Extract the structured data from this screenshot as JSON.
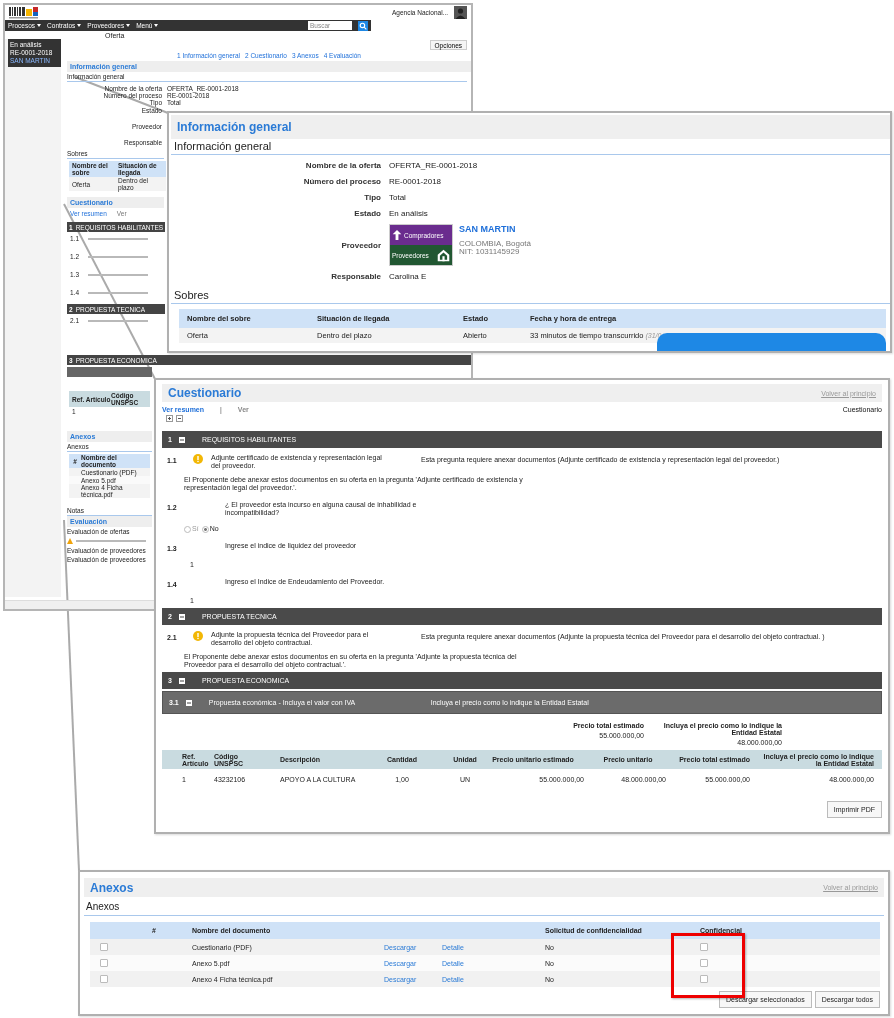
{
  "page": {
    "nav": [
      "Procesos",
      "Contratos",
      "Proveedores",
      "Menú"
    ],
    "search_placeholder": "Buscar",
    "account": "Agencia Nacional...",
    "breadcrumb": "Oferta",
    "status_box": [
      "En análisis",
      "RE-0001-2018",
      "SAN MARTIN"
    ],
    "options": "Opciones",
    "anchors": [
      "1 Información general",
      "2 Cuestionario",
      "3 Anexos",
      "4 Evaluación"
    ],
    "info_title": "Información general",
    "info_sub": "Información general",
    "fields": [
      {
        "label": "Nombre de la oferta",
        "value": "OFERTA_RE-0001-2018"
      },
      {
        "label": "Número del proceso",
        "value": "RE-0001-2018"
      },
      {
        "label": "Tipo",
        "value": "Total"
      },
      {
        "label": "Estado"
      },
      {
        "label": "Proveedor"
      },
      {
        "label": "Responsable"
      }
    ],
    "sobres_title": "Sobres",
    "sobres_columns": [
      "Nombre del sobre",
      "Situación de llegada"
    ],
    "sobres_row": [
      "Oferta",
      "Dentro del plazo"
    ],
    "cuestionario_title": "Cuestionario",
    "view_links": [
      "Ver resumen",
      "Ver"
    ],
    "sections": [
      {
        "number": "1",
        "title": "REQUISITOS HABILITANTES",
        "items": [
          "1.1",
          "1.2",
          "1.3",
          "1.4"
        ]
      },
      {
        "number": "2",
        "title": "PROPUESTA TECNICA",
        "items": [
          "2.1"
        ]
      },
      {
        "number": "3",
        "title": "PROPUESTA ECONOMICA"
      }
    ],
    "item_table_columns": [
      "Ref. Artículo",
      "Código UNSPSC"
    ],
    "item_table_row": [
      "1"
    ],
    "anexos_title": "Anexos",
    "anexos_sub": "Anexos",
    "anexos_columns": [
      "#",
      "Nombre del documento"
    ],
    "anexos_rows": [
      "Cuestionario (PDF)",
      "Anexo 5.pdf",
      "Anexo 4 Ficha técnica.pdf"
    ],
    "notas": "Notas",
    "evaluacion_title": "Evaluación",
    "evaluacion_ofertas": "Evaluación de ofertas",
    "evaluacion_proveedores": "Evaluación de proveedores",
    "evaluacion_proveedores_sub": "Evaluación de proveedores"
  },
  "info_zoom": {
    "title": "Información general",
    "subtitle": "Información general",
    "fields": [
      {
        "label": "Nombre de la oferta",
        "value": "OFERTA_RE-0001-2018"
      },
      {
        "label": "Número del proceso",
        "value": "RE-0001-2018"
      },
      {
        "label": "Tipo",
        "value": "Total"
      },
      {
        "label": "Estado",
        "value": "En análisis"
      }
    ],
    "provider": {
      "label": "Proveedor",
      "logo_top": "Compradores",
      "logo_bottom": "Proveedores",
      "name": "SAN MARTIN",
      "location": "COLOMBIA, Bogotá",
      "nit": "NIT: 1031145929"
    },
    "responsible": {
      "label": "Responsable",
      "value": "Carolina E"
    },
    "sobres_title": "Sobres",
    "sobres_columns": [
      "Nombre del sobre",
      "Situación de llegada",
      "Estado",
      "Fecha y hora de entrega"
    ],
    "sobres_row": {
      "name": "Oferta",
      "arrival": "Dentro del plazo",
      "state": "Abierto",
      "elapsed": "33 minutos de tiempo transcurrido",
      "date": "(31/0"
    }
  },
  "cuestionario_zoom": {
    "title": "Cuestionario",
    "back_link": "Volver al principio",
    "view_links": [
      {
        "label": "Ver resumen",
        "selected": true
      },
      {
        "label": "Ver",
        "selected": false
      }
    ],
    "view_separator": "|",
    "right_label": "Cuestionario",
    "sections": [
      {
        "number": "1",
        "title": "REQUISITOS HABILITANTES",
        "questions": [
          {
            "number": "1.1",
            "kind": "document",
            "text": "Adjunte certificado de existencia y representación legal del proveedor.",
            "requirement": "Esta pregunta requiere anexar documentos (Adjunte certificado de existencia y representación legal del proveedor.)",
            "note": "El Proponente debe anexar estos documentos en su oferta en la pregunta 'Adjunte certificado de existencia y representación legal del proveedor.'."
          },
          {
            "number": "1.2",
            "kind": "choice",
            "text": "¿ El proveedor esta incurso en alguna causal de inhabilidad e incompatibilidad?",
            "options": [
              {
                "label": "Sí",
                "selected": false
              },
              {
                "label": "No",
                "selected": true
              }
            ]
          },
          {
            "number": "1.3",
            "kind": "answer",
            "text": "Ingrese el indice de liquidez del proveedor",
            "answer": "1"
          },
          {
            "number": "1.4",
            "kind": "answer",
            "text": "Ingreso el Indice de Endeudamiento del Proveedor.",
            "answer": "1"
          }
        ]
      },
      {
        "number": "2",
        "title": "PROPUESTA TECNICA",
        "questions": [
          {
            "number": "2.1",
            "kind": "document",
            "text": "Adjunte la propuesta técnica del Proveedor para el desarrollo del objeto contractual.",
            "requirement": "Esta pregunta requiere anexar documentos (Adjunte la propuesta técnica del Proveedor para el desarrollo del objeto contractual. )",
            "note": "El Proponente debe anexar estos documentos en su oferta en la pregunta 'Adjunte la propuesta técnica del Proveedor para el desarrollo del objeto contractual.'."
          }
        ]
      },
      {
        "number": "3",
        "title": "PROPUESTA ECONOMICA"
      }
    ],
    "economic": {
      "number": "3.1",
      "text": "Propuesta económica - Incluya el valor con IVA",
      "hint": "Incluya el precio como lo indique la Entidad Estatal",
      "summary_labels": [
        "Precio total estimado",
        "Incluya el precio como lo indique la Entidad Estatal"
      ],
      "summary_values": [
        "55.000.000,00",
        "48.000.000,00"
      ],
      "columns": [
        "Ref. Artículo",
        "Código UNSPSC",
        "Descripción",
        "Cantidad",
        "Unidad",
        "Precio unitario estimado",
        "Precio unitario",
        "Precio total estimado",
        "Incluya el precio como lo indique la Entidad Estatal"
      ],
      "rows": [
        [
          "1",
          "43232106",
          "APOYO A LA CULTURA",
          "1,00",
          "UN",
          "55.000.000,00",
          "48.000.000,00",
          "55.000.000,00",
          "48.000.000,00"
        ]
      ]
    },
    "print_button": "Imprimir PDF"
  },
  "anexos_zoom": {
    "title": "Anexos",
    "back_link": "Volver al principio",
    "subtitle": "Anexos",
    "columns": [
      "#",
      "Nombre del documento",
      "Solicitud de confidencialidad",
      "Confidencial"
    ],
    "rows": [
      {
        "checked": false,
        "name": "Cuestionario (PDF)",
        "download": "Descargar",
        "detail": "Detalle",
        "request": "No",
        "confidential": false
      },
      {
        "checked": false,
        "name": "Anexo 5.pdf",
        "download": "Descargar",
        "detail": "Detalle",
        "request": "No",
        "confidential": false
      },
      {
        "checked": false,
        "name": "Anexo 4 Ficha técnica.pdf",
        "download": "Descargar",
        "detail": "Detalle",
        "request": "No",
        "confidential": false
      }
    ],
    "buttons": [
      "Descargar seleccionados",
      "Descargar todos"
    ]
  }
}
